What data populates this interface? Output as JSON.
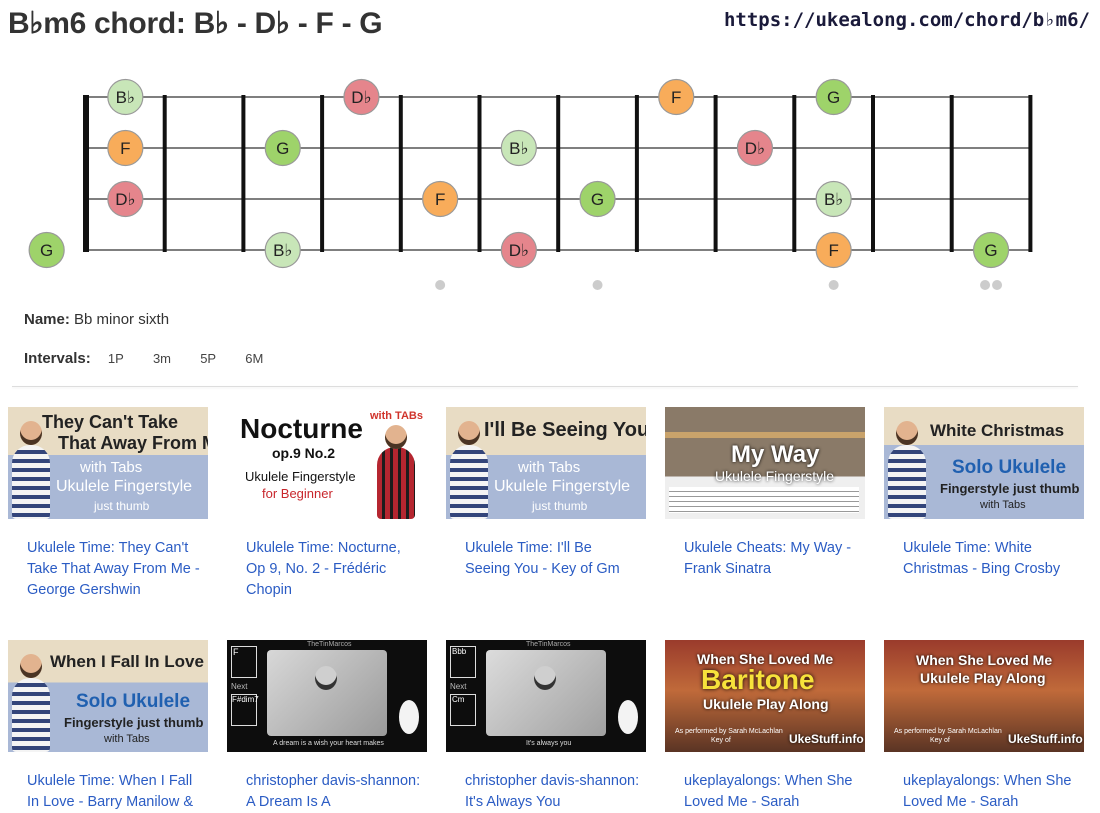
{
  "header": {
    "title": "B♭m6 chord: B♭ - D♭ - F - G",
    "url": "https://ukealong.com/chord/b♭m6/"
  },
  "fretboard": {
    "strings": 4,
    "frets": 12,
    "note_colors": {
      "B♭": "#c8e6b8",
      "D♭": "#e5858c",
      "F": "#f8ac5a",
      "G": "#9ed36a"
    },
    "notes": [
      {
        "string": 1,
        "fret": 0,
        "label": "B♭",
        "note": "B♭"
      },
      {
        "string": 1,
        "fret": 3,
        "label": "D♭",
        "note": "D♭"
      },
      {
        "string": 1,
        "fret": 7,
        "label": "F",
        "note": "F"
      },
      {
        "string": 1,
        "fret": 9,
        "label": "G",
        "note": "G"
      },
      {
        "string": 2,
        "fret": 0,
        "label": "F",
        "note": "F"
      },
      {
        "string": 2,
        "fret": 2,
        "label": "G",
        "note": "G"
      },
      {
        "string": 2,
        "fret": 5,
        "label": "B♭",
        "note": "B♭"
      },
      {
        "string": 2,
        "fret": 8,
        "label": "D♭",
        "note": "D♭"
      },
      {
        "string": 3,
        "fret": 0,
        "label": "D♭",
        "note": "D♭"
      },
      {
        "string": 3,
        "fret": 4,
        "label": "F",
        "note": "F"
      },
      {
        "string": 3,
        "fret": 6,
        "label": "G",
        "note": "G"
      },
      {
        "string": 3,
        "fret": 9,
        "label": "B♭",
        "note": "B♭"
      },
      {
        "string": 4,
        "fret": -1,
        "label": "G",
        "note": "G"
      },
      {
        "string": 4,
        "fret": 2,
        "label": "B♭",
        "note": "B♭"
      },
      {
        "string": 4,
        "fret": 5,
        "label": "D♭",
        "note": "D♭"
      },
      {
        "string": 4,
        "fret": 9,
        "label": "F",
        "note": "F"
      },
      {
        "string": 4,
        "fret": 11,
        "label": "G",
        "note": "G"
      }
    ],
    "markers": [
      {
        "fret": 5,
        "count": 1
      },
      {
        "fret": 7,
        "count": 1
      },
      {
        "fret": 10,
        "count": 1
      },
      {
        "fret": 12,
        "count": 2
      }
    ]
  },
  "chord_info": {
    "name_label": "Name:",
    "name_value": "Bb minor sixth",
    "intervals_label": "Intervals:",
    "intervals": [
      "1P",
      "3m",
      "5P",
      "6M"
    ]
  },
  "videos": [
    {
      "caption": "Ukulele Time: They Can't Take That Away From Me - George Gershwin",
      "thumb": {
        "title1": "They Can't Take",
        "title2": "That Away From Me",
        "sub1": "with Tabs",
        "sub2": "Ukulele Fingerstyle",
        "sub3": "just thumb"
      }
    },
    {
      "caption": "Ukulele Time: Nocturne, Op 9, No. 2 - Frédéric Chopin",
      "thumb": {
        "title1": "Nocturne",
        "title2": "op.9 No.2",
        "tag": "with TABs",
        "sub1": "Ukulele Fingerstyle",
        "sub2": "for Beginner"
      }
    },
    {
      "caption": "Ukulele Time: I'll Be Seeing You - Key of Gm",
      "thumb": {
        "title1": "I'll Be Seeing You",
        "sub1": "with Tabs",
        "sub2": "Ukulele Fingerstyle",
        "sub3": "just thumb"
      }
    },
    {
      "caption": "Ukulele Cheats: My Way - Frank Sinatra",
      "thumb": {
        "title1": "My Way",
        "sub1": "Ukulele Fingerstyle"
      }
    },
    {
      "caption": "Ukulele Time: White Christmas - Bing Crosby",
      "thumb": {
        "title1": "White Christmas",
        "sub1": "Solo Ukulele",
        "sub2": "Fingerstyle just thumb",
        "sub3": "with Tabs"
      }
    },
    {
      "caption": "Ukulele Time: When I Fall In Love - Barry Manilow &",
      "thumb": {
        "title1": "When I Fall In Love",
        "sub1": "Solo Ukulele",
        "sub2": "Fingerstyle just thumb",
        "sub3": "with Tabs"
      }
    },
    {
      "caption": "christopher davis-shannon: A Dream Is A",
      "thumb": {
        "chord1": "F",
        "chord2": "F#dim7",
        "next_label": "Next",
        "brand": "TheTinMarcos",
        "bottom": "A dream is a wish your heart makes"
      }
    },
    {
      "caption": "christopher davis-shannon: It's Always You",
      "thumb": {
        "chord1": "Bbb",
        "chord2": "Cm",
        "next_label": "Next",
        "brand": "TheTinMarcos",
        "bottom": "It's always you"
      }
    },
    {
      "caption": "ukeplayalongs: When She Loved Me - Sarah",
      "thumb": {
        "title1": "When She Loved Me",
        "title2": "Baritone",
        "sub1": "Ukulele Play Along",
        "credit": "As performed by Sarah McLachlan",
        "key": "Key of",
        "brand": "UkeStuff.info"
      }
    },
    {
      "caption": "ukeplayalongs: When She Loved Me - Sarah",
      "thumb": {
        "title1": "When She Loved Me",
        "sub1": "Ukulele Play Along",
        "credit": "As performed by Sarah McLachlan",
        "key": "Key of",
        "brand": "UkeStuff.info"
      }
    }
  ]
}
